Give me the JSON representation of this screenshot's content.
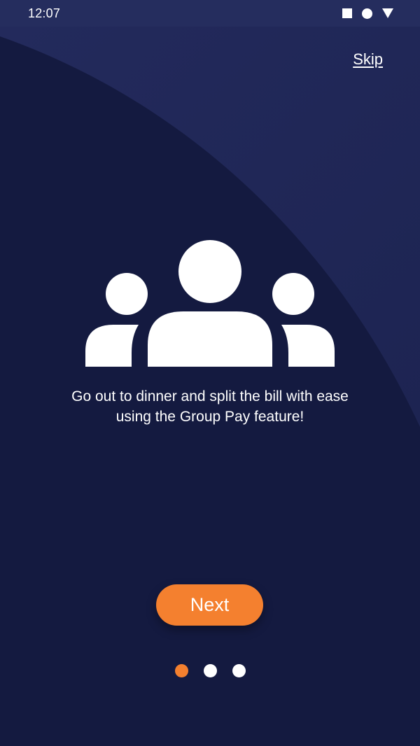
{
  "status_bar": {
    "time": "12:07",
    "icons": [
      "square-icon",
      "circle-icon",
      "triangle-icon"
    ]
  },
  "header": {
    "skip_label": "Skip"
  },
  "illustration": {
    "icon": "group-people-icon"
  },
  "onboarding": {
    "caption": "Go out to dinner and split the bill with ease using the Group Pay feature!"
  },
  "actions": {
    "next_label": "Next"
  },
  "pager": {
    "page_count": 3,
    "current_page": 1
  },
  "colors": {
    "background": "#141a40",
    "status_bar": "#252d5e",
    "accent": "#f4802f",
    "foreground": "#ffffff"
  }
}
